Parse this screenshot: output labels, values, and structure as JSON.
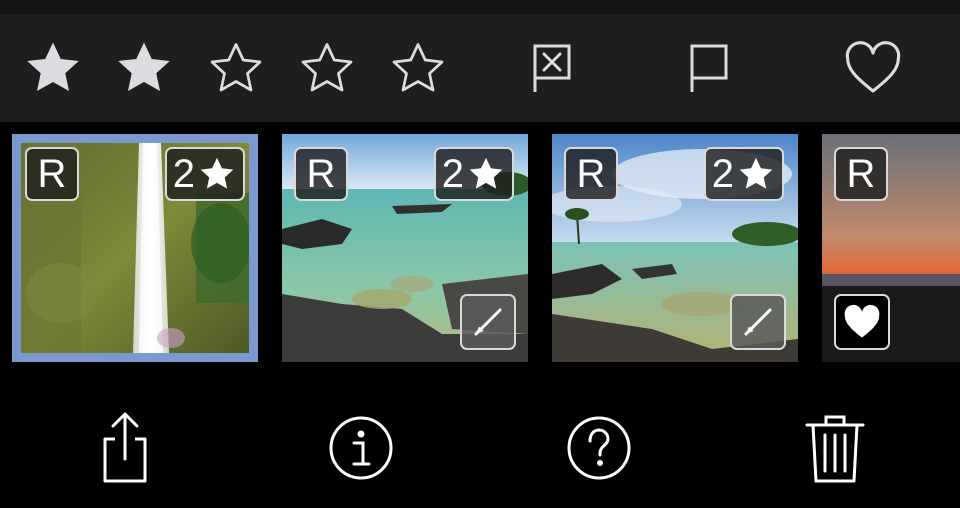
{
  "toolbar": {
    "rating_stars": [
      {
        "name": "star-1",
        "filled": true
      },
      {
        "name": "star-2",
        "filled": true
      },
      {
        "name": "star-3",
        "filled": false
      },
      {
        "name": "star-4",
        "filled": false
      },
      {
        "name": "star-5",
        "filled": false
      }
    ],
    "reject_icon": "flag-reject-icon",
    "flag_icon": "flag-icon",
    "favorite_icon": "heart-icon"
  },
  "filmstrip": [
    {
      "name": "waterfall",
      "raw_label": "R",
      "rating_label": "2",
      "selected": true,
      "edited": false,
      "favorite": false
    },
    {
      "name": "lava-rock-shore",
      "raw_label": "R",
      "rating_label": "2",
      "selected": false,
      "edited": true,
      "favorite": false
    },
    {
      "name": "tide-pool-palms",
      "raw_label": "R",
      "rating_label": "2",
      "selected": false,
      "edited": true,
      "favorite": false
    },
    {
      "name": "sunset-beach",
      "raw_label": "R",
      "rating_label": "",
      "selected": false,
      "edited": false,
      "favorite": true
    }
  ],
  "bottom_bar": {
    "icons": [
      "share-icon",
      "info-icon",
      "help-icon",
      "trash-icon"
    ]
  },
  "colors": {
    "toolbar_bg": "#1e1e1e",
    "selection_border": "#7b98cf",
    "icon": "#dcdce0"
  }
}
